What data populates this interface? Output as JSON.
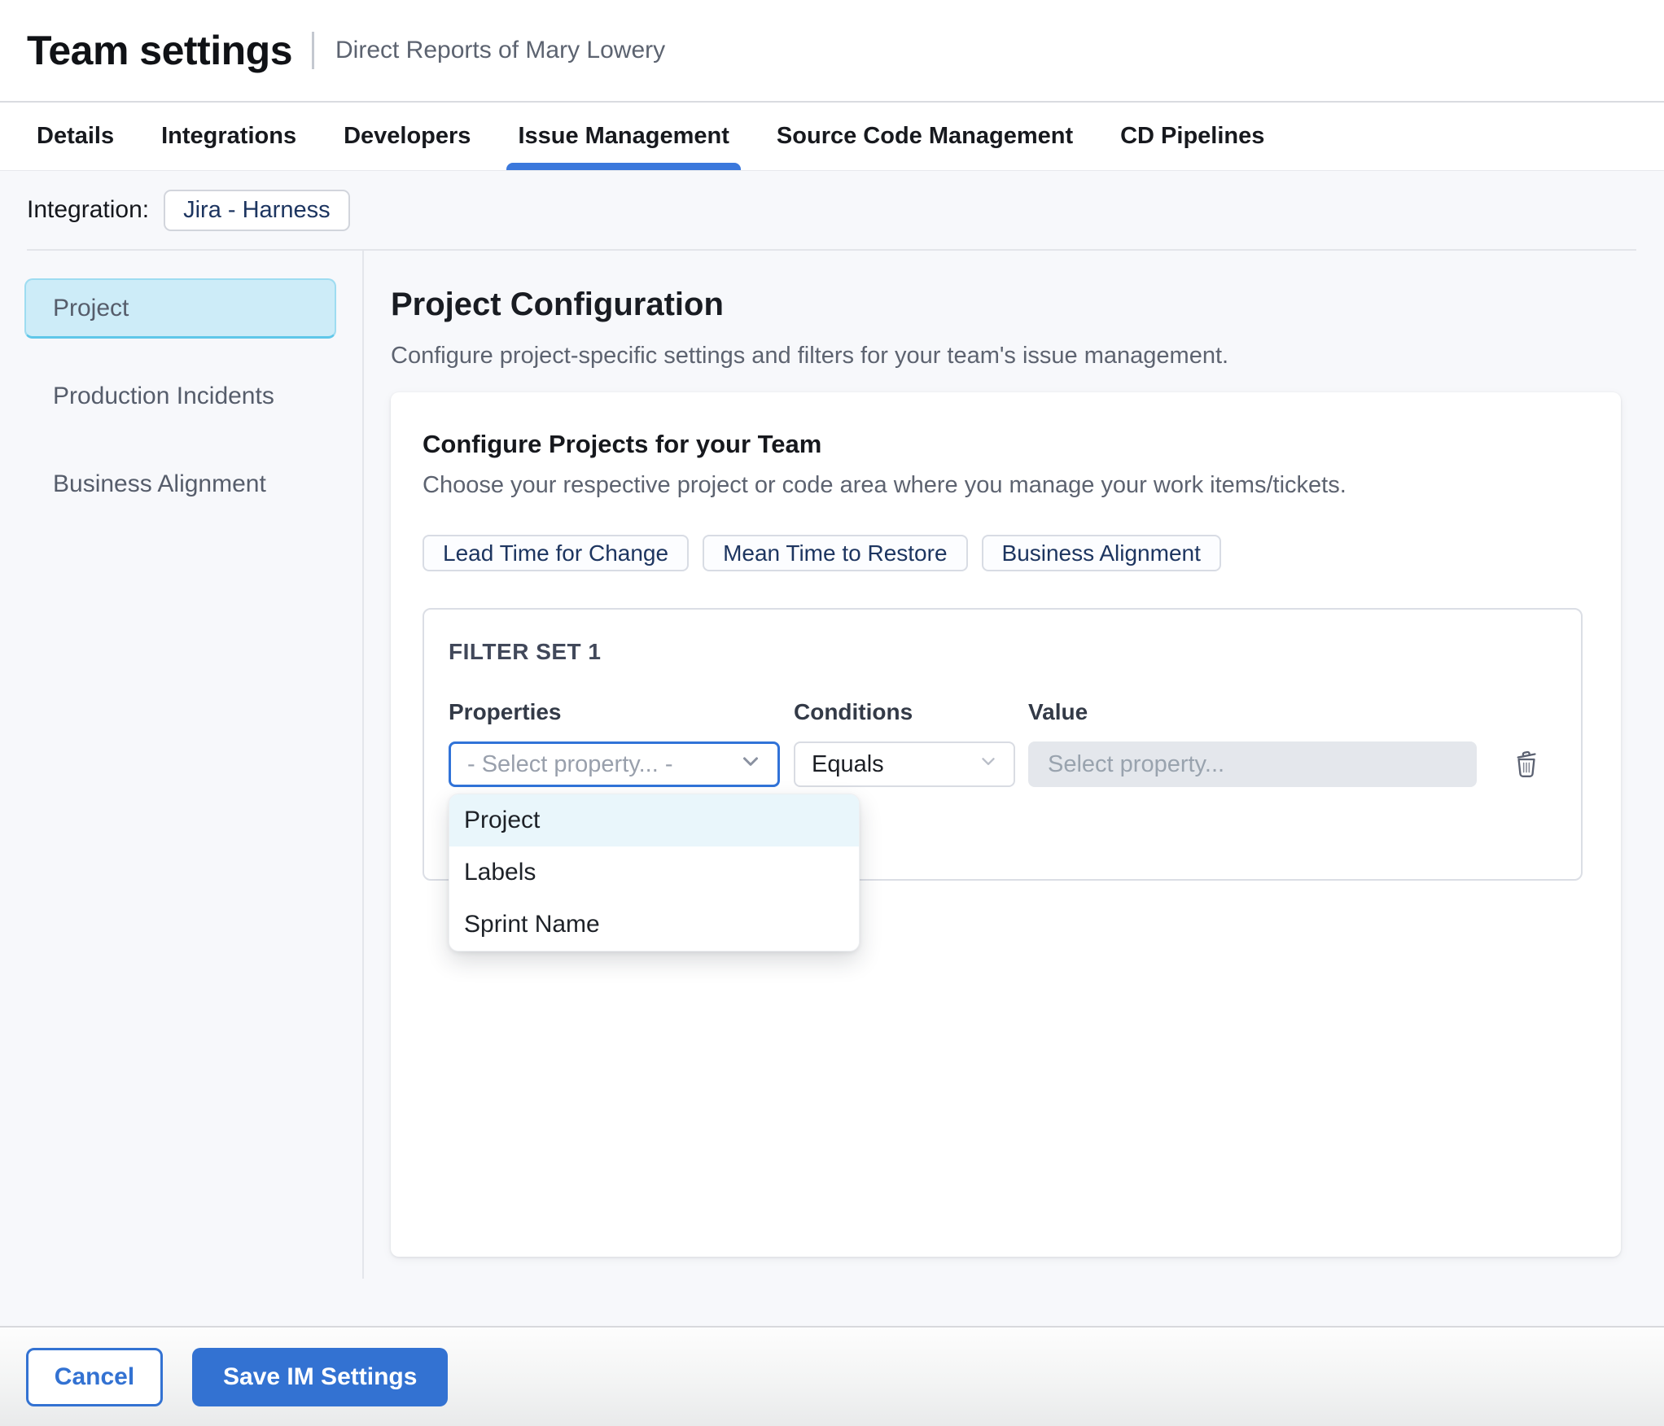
{
  "header": {
    "title": "Team settings",
    "subtitle": "Direct Reports of Mary Lowery"
  },
  "tabs": [
    {
      "label": "Details",
      "active": false
    },
    {
      "label": "Integrations",
      "active": false
    },
    {
      "label": "Developers",
      "active": false
    },
    {
      "label": "Issue Management",
      "active": true
    },
    {
      "label": "Source Code Management",
      "active": false
    },
    {
      "label": "CD Pipelines",
      "active": false
    }
  ],
  "integration": {
    "label": "Integration:",
    "value": "Jira - Harness"
  },
  "sidebar": {
    "items": [
      {
        "label": "Project",
        "selected": true
      },
      {
        "label": "Production Incidents",
        "selected": false
      },
      {
        "label": "Business Alignment",
        "selected": false
      }
    ]
  },
  "main": {
    "title": "Project Configuration",
    "description": "Configure project-specific settings and filters for your team's issue management.",
    "card": {
      "title": "Configure Projects for your Team",
      "description": "Choose your respective project or code area where you manage your work items/tickets.",
      "chips": [
        {
          "label": "Lead Time for Change"
        },
        {
          "label": "Mean Time to Restore"
        },
        {
          "label": "Business Alignment"
        }
      ],
      "filter_set": {
        "title": "FILTER SET 1",
        "properties_label": "Properties",
        "conditions_label": "Conditions",
        "value_label": "Value",
        "properties_placeholder": "- Select property... -",
        "conditions_value": "Equals",
        "value_placeholder": "Select property...",
        "dropdown": {
          "options": [
            {
              "label": "Project",
              "highlighted": true
            },
            {
              "label": "Labels",
              "highlighted": false
            },
            {
              "label": "Sprint Name",
              "highlighted": false
            }
          ]
        }
      }
    }
  },
  "footer": {
    "cancel_label": "Cancel",
    "save_label": "Save IM Settings"
  },
  "colors": {
    "accent_blue": "#3372d2",
    "tab_underline": "#3b78dc",
    "page_bg": "#f7f8fb",
    "selected_item_bg": "#cdecf8",
    "selected_item_border": "#5fc7e9",
    "chip_text": "#1d3560",
    "dropdown_highlight": "#e9f6fb",
    "disabled_input_bg": "#e4e7ec",
    "properties_focus_border": "#3173d8"
  }
}
